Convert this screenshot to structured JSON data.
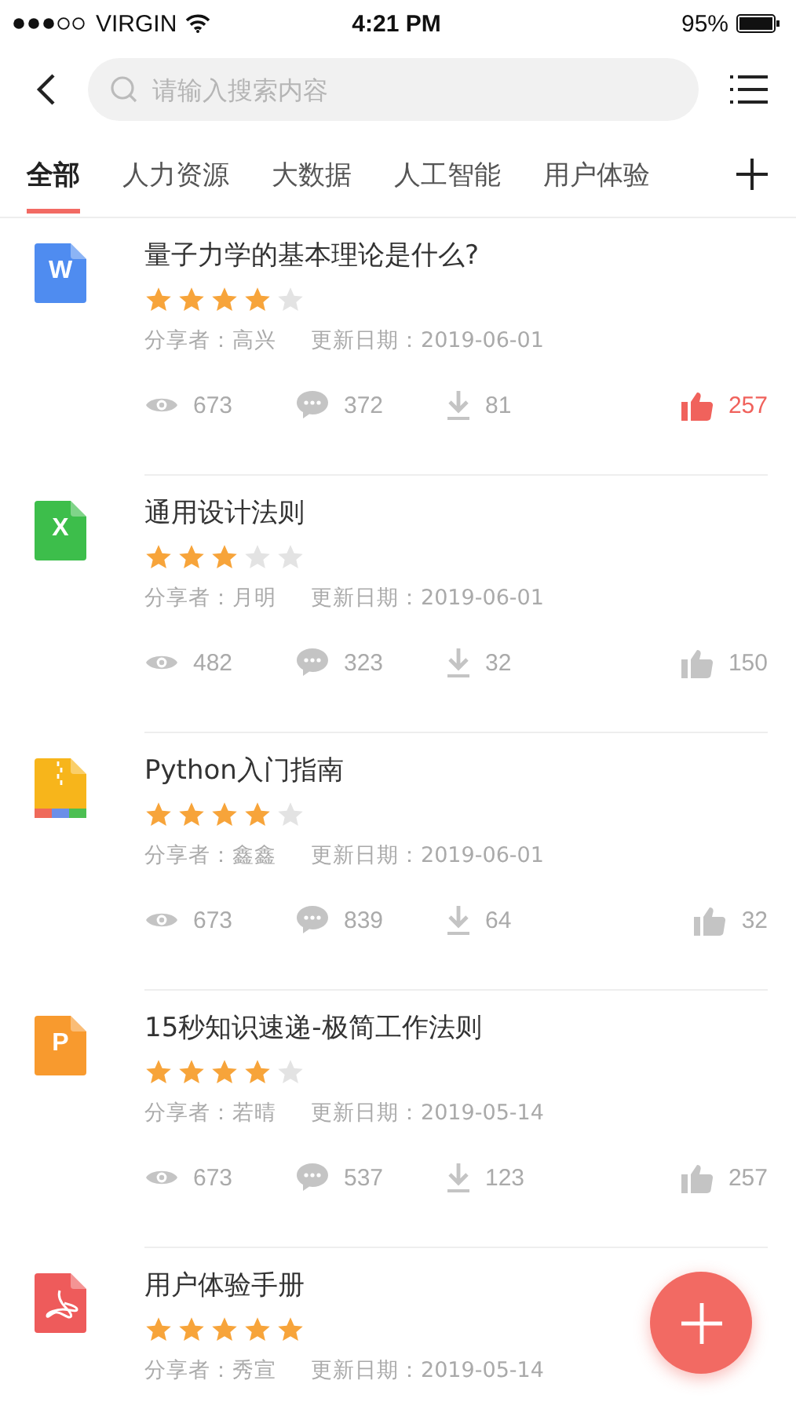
{
  "status_bar": {
    "carrier": "VIRGIN",
    "time": "4:21 PM",
    "battery": "95%"
  },
  "search": {
    "placeholder": "请输入搜索内容"
  },
  "tabs": [
    {
      "label": "全部",
      "selected": true
    },
    {
      "label": "人力资源",
      "selected": false
    },
    {
      "label": "大数据",
      "selected": false
    },
    {
      "label": "人工智能",
      "selected": false
    },
    {
      "label": "用户体验",
      "selected": false
    }
  ],
  "items": [
    {
      "kind": "word",
      "badge": "W",
      "title": "量子力学的基本理论是什么?",
      "stars": 4,
      "sharer": "分享者：高兴",
      "date": "更新日期：2019-06-01",
      "views": "673",
      "comments": "372",
      "downloads": "81",
      "likes": "257",
      "liked": true
    },
    {
      "kind": "excel",
      "badge": "X",
      "title": "通用设计法则",
      "stars": 3,
      "sharer": "分享者：月明",
      "date": "更新日期：2019-06-01",
      "views": "482",
      "comments": "323",
      "downloads": "32",
      "likes": "150",
      "liked": false
    },
    {
      "kind": "zip",
      "title": "Python入门指南",
      "stars": 4,
      "sharer": "分享者：鑫鑫",
      "date": "更新日期：2019-06-01",
      "views": "673",
      "comments": "839",
      "downloads": "64",
      "likes": "32",
      "liked": false
    },
    {
      "kind": "ppt",
      "badge": "P",
      "title": "15秒知识速递-极简工作法则",
      "stars": 4,
      "sharer": "分享者：若晴",
      "date": "更新日期：2019-05-14",
      "views": "673",
      "comments": "537",
      "downloads": "123",
      "likes": "257",
      "liked": false
    },
    {
      "kind": "pdf",
      "title": "用户体验手册",
      "stars": 5,
      "sharer": "分享者：秀宣",
      "date": "更新日期：2019-05-14"
    }
  ]
}
